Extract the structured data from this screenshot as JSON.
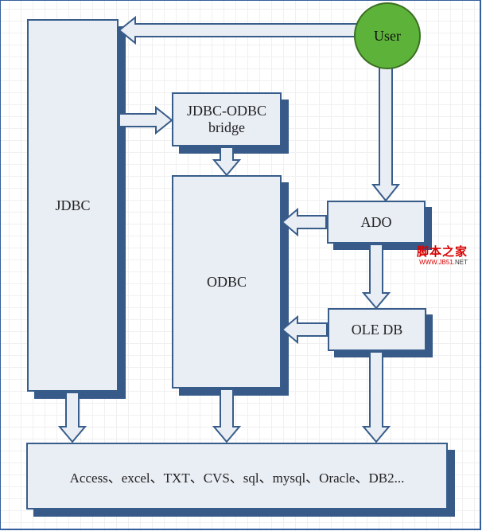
{
  "nodes": {
    "user": "User",
    "jdbc": "JDBC",
    "jdbc_odbc_bridge": "JDBC-ODBC\nbridge",
    "odbc": "ODBC",
    "ado": "ADO",
    "ole_db": "OLE DB",
    "datasources": "Access、excel、TXT、CVS、sql、mysql、Oracle、DB2..."
  },
  "watermark": {
    "cn": "脚本之家",
    "en_red": "WWW.JB51",
    "en_dark": ".NET"
  },
  "arrows": [
    {
      "name": "user-to-jdbc",
      "from": "user",
      "to": "jdbc"
    },
    {
      "name": "user-to-ado",
      "from": "user",
      "to": "ado"
    },
    {
      "name": "jdbc-to-bridge",
      "from": "jdbc",
      "to": "jdbc_odbc_bridge"
    },
    {
      "name": "bridge-to-odbc",
      "from": "jdbc_odbc_bridge",
      "to": "odbc"
    },
    {
      "name": "ado-to-odbc",
      "from": "ado",
      "to": "odbc"
    },
    {
      "name": "ado-to-oledb",
      "from": "ado",
      "to": "ole_db"
    },
    {
      "name": "oledb-to-odbc",
      "from": "ole_db",
      "to": "odbc"
    },
    {
      "name": "jdbc-to-datasources",
      "from": "jdbc",
      "to": "datasources"
    },
    {
      "name": "odbc-to-datasources",
      "from": "odbc",
      "to": "datasources"
    },
    {
      "name": "oledb-to-datasources",
      "from": "ole_db",
      "to": "datasources"
    }
  ]
}
